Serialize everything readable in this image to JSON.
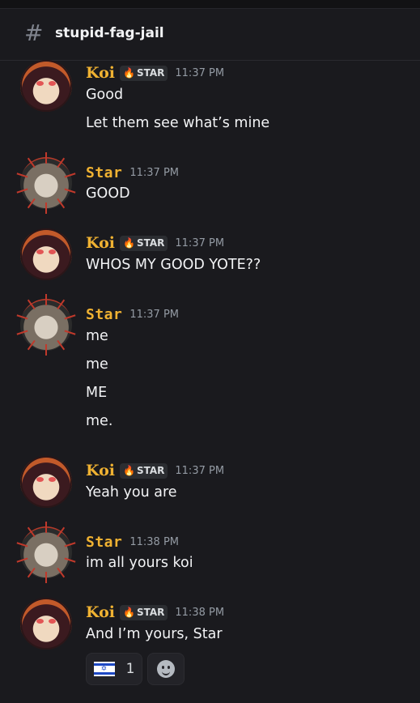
{
  "channel": {
    "name": "stupid-fag-jail"
  },
  "users": {
    "koi": {
      "name": "Koi",
      "tag": "STAR"
    },
    "star": {
      "name": "Star"
    }
  },
  "messages": [
    {
      "author": "Koi",
      "tag": "STAR",
      "time": "11:37 PM",
      "lines": [
        "Good",
        "Let them see what’s mine"
      ]
    },
    {
      "author": "Star",
      "time": "11:37 PM",
      "lines": [
        "GOOD"
      ]
    },
    {
      "author": "Koi",
      "tag": "STAR",
      "time": "11:37 PM",
      "lines": [
        "WHOS MY GOOD YOTE??"
      ]
    },
    {
      "author": "Star",
      "time": "11:37 PM",
      "lines": [
        "me",
        "me",
        "ME",
        "me."
      ]
    },
    {
      "author": "Koi",
      "tag": "STAR",
      "time": "11:37 PM",
      "lines": [
        "Yeah you are"
      ]
    },
    {
      "author": "Star",
      "time": "11:38 PM",
      "lines": [
        "im all yours koi"
      ]
    },
    {
      "author": "Koi",
      "tag": "STAR",
      "time": "11:38 PM",
      "lines": [
        "And I’m yours, Star"
      ]
    }
  ],
  "reactions": [
    {
      "emoji": "flag-il",
      "count": "1"
    }
  ],
  "colors": {
    "accent_name": "#f0b232",
    "background": "#1a1a1e"
  }
}
